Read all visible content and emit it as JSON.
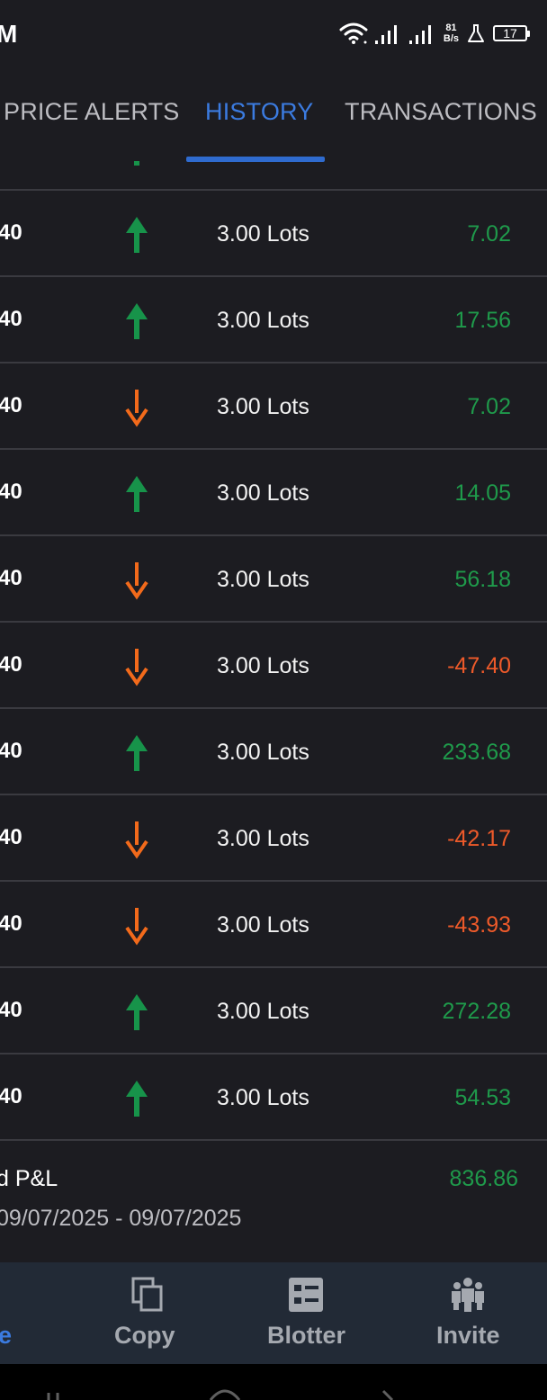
{
  "status_bar": {
    "time": "M",
    "net_speed_value": "81",
    "net_speed_unit": "B/s",
    "battery_level": "17"
  },
  "tabs": [
    {
      "label": "PRICE ALERTS",
      "active": false
    },
    {
      "label": "HISTORY",
      "active": true
    },
    {
      "label": "TRANSACTIONS",
      "active": false
    }
  ],
  "rows": [
    {
      "left_value": "40",
      "direction": "up",
      "volume": "3.00 Lots",
      "pnl": "7.02",
      "pnl_sign": "positive"
    },
    {
      "left_value": "40",
      "direction": "up",
      "volume": "3.00 Lots",
      "pnl": "17.56",
      "pnl_sign": "positive"
    },
    {
      "left_value": "40",
      "direction": "down",
      "volume": "3.00 Lots",
      "pnl": "7.02",
      "pnl_sign": "positive"
    },
    {
      "left_value": "40",
      "direction": "up",
      "volume": "3.00 Lots",
      "pnl": "14.05",
      "pnl_sign": "positive"
    },
    {
      "left_value": "40",
      "direction": "down",
      "volume": "3.00 Lots",
      "pnl": "56.18",
      "pnl_sign": "positive"
    },
    {
      "left_value": "40",
      "direction": "down",
      "volume": "3.00 Lots",
      "pnl": "-47.40",
      "pnl_sign": "negative"
    },
    {
      "left_value": "40",
      "direction": "up",
      "volume": "3.00 Lots",
      "pnl": "233.68",
      "pnl_sign": "positive"
    },
    {
      "left_value": "40",
      "direction": "down",
      "volume": "3.00 Lots",
      "pnl": "-42.17",
      "pnl_sign": "negative"
    },
    {
      "left_value": "40",
      "direction": "down",
      "volume": "3.00 Lots",
      "pnl": "-43.93",
      "pnl_sign": "negative"
    },
    {
      "left_value": "40",
      "direction": "up",
      "volume": "3.00 Lots",
      "pnl": "272.28",
      "pnl_sign": "positive"
    },
    {
      "left_value": "40",
      "direction": "up",
      "volume": "3.00 Lots",
      "pnl": "54.53",
      "pnl_sign": "positive"
    }
  ],
  "summary": {
    "label": "d P&L",
    "value": "836.86",
    "date_range": "09/07/2025 - 09/07/2025"
  },
  "bottom_nav": [
    {
      "label": "e",
      "icon": "partial-icon",
      "active": true
    },
    {
      "label": "Copy",
      "icon": "copy-icon",
      "active": false
    },
    {
      "label": "Blotter",
      "icon": "blotter-icon",
      "active": false
    },
    {
      "label": "Invite",
      "icon": "people-icon",
      "active": false
    }
  ],
  "colors": {
    "background": "#1c1c21",
    "accent": "#3b7be0",
    "positive": "#1f9a4b",
    "negative": "#ee5a2a",
    "up_arrow": "#17934a",
    "down_arrow": "#f26a1b"
  }
}
